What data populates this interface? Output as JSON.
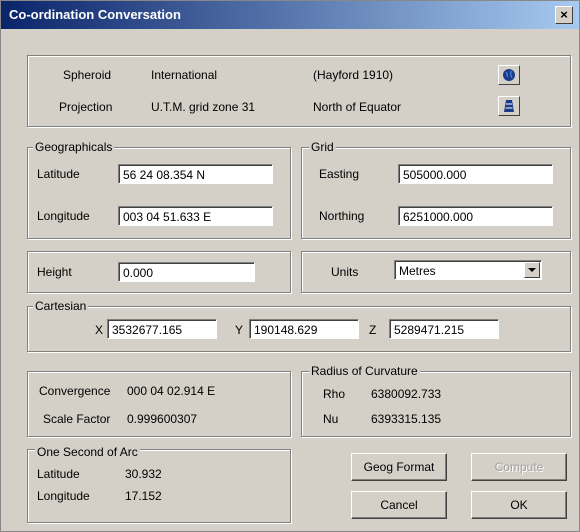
{
  "window": {
    "title": "Co-ordination Conversation",
    "close_label": "×"
  },
  "spheroid": {
    "label": "Spheroid",
    "value": "International",
    "detail": "(Hayford 1910)",
    "icon": "globe-icon"
  },
  "projection": {
    "label": "Projection",
    "value": "U.T.M. grid zone 31",
    "detail": "North of Equator",
    "icon": "projection-icon"
  },
  "geographicals": {
    "title": "Geographicals",
    "latitude_label": "Latitude",
    "latitude": "56 24 08.354 N",
    "longitude_label": "Longitude",
    "longitude": "003 04 51.633 E"
  },
  "grid": {
    "title": "Grid",
    "easting_label": "Easting",
    "easting": "505000.000",
    "northing_label": "Northing",
    "northing": "6251000.000"
  },
  "height": {
    "label": "Height",
    "value": "0.000"
  },
  "units": {
    "label": "Units",
    "value": "Metres"
  },
  "cartesian": {
    "title": "Cartesian",
    "x_label": "X",
    "x": "3532677.165",
    "y_label": "Y",
    "y": "190148.629",
    "z_label": "Z",
    "z": "5289471.215"
  },
  "convergence": {
    "label": "Convergence",
    "value": "000 04 02.914 E"
  },
  "scale_factor": {
    "label": "Scale Factor",
    "value": "0.999600307"
  },
  "radius": {
    "title": "Radius of Curvature",
    "rho_label": "Rho",
    "rho": "6380092.733",
    "nu_label": "Nu",
    "nu": "6393315.135"
  },
  "arc": {
    "title": "One Second of Arc",
    "latitude_label": "Latitude",
    "latitude": "30.932",
    "longitude_label": "Longitude",
    "longitude": "17.152"
  },
  "buttons": {
    "geog_format": "Geog Format",
    "compute": "Compute",
    "cancel": "Cancel",
    "ok": "OK"
  }
}
